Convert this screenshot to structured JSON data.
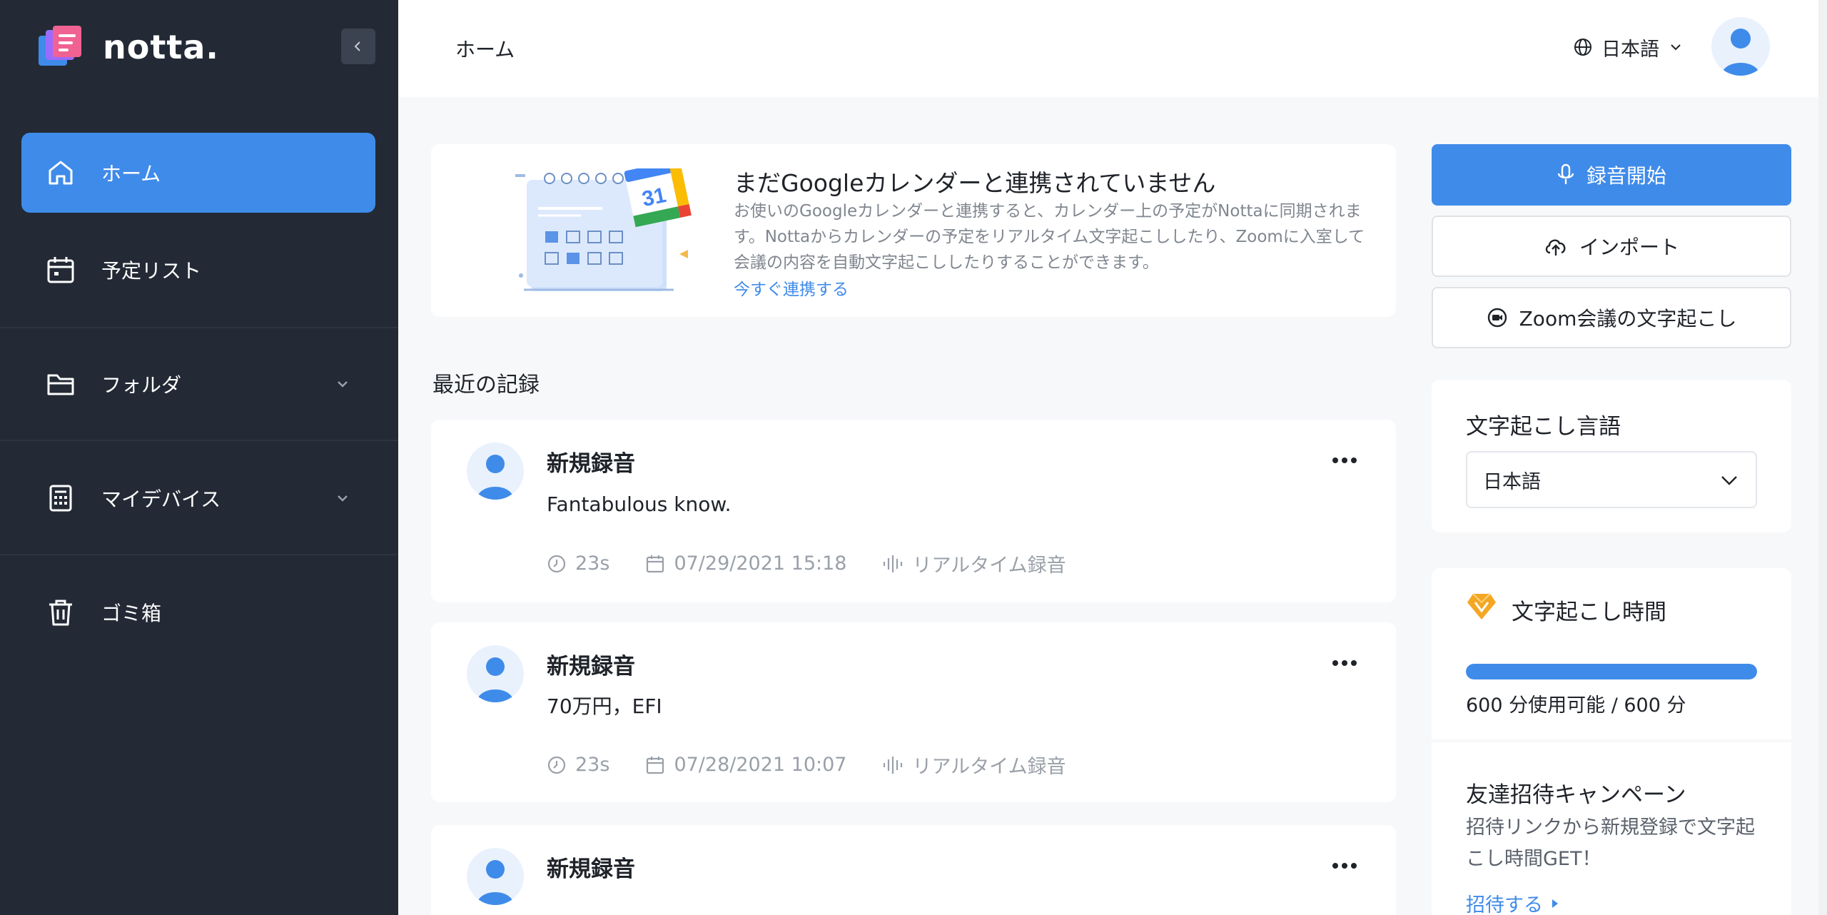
{
  "app": {
    "logo_text": "notta.",
    "brand_color": "#3f8bea",
    "sidebar_bg": "#232a35"
  },
  "sidebar": {
    "items": [
      {
        "label": "ホーム",
        "icon": "home-icon",
        "active": true
      },
      {
        "label": "予定リスト",
        "icon": "calendar-icon"
      },
      {
        "label": "フォルダ",
        "icon": "folder-icon",
        "expandable": true
      },
      {
        "label": "マイデバイス",
        "icon": "device-icon",
        "expandable": true
      },
      {
        "label": "ゴミ箱",
        "icon": "trash-icon"
      }
    ]
  },
  "header": {
    "title": "ホーム",
    "language": "日本語"
  },
  "banner": {
    "title": "まだGoogleカレンダーと連携されていません",
    "description": "お使いのGoogleカレンダーと連携すると、カレンダー上の予定がNottaに同期されます。Nottaからカレンダーの予定をリアルタイム文字起こししたり、Zoomに入室して会議の内容を自動文字起こししたりすることができます。",
    "link": "今すぐ連携する",
    "calendar_day": "31"
  },
  "recent": {
    "title": "最近の記録",
    "records": [
      {
        "title": "新規録音",
        "text": "Fantabulous know.",
        "duration": "23s",
        "date": "07/29/2021 15:18",
        "type": "リアルタイム録音"
      },
      {
        "title": "新規録音",
        "text": "70万円，EFI",
        "duration": "23s",
        "date": "07/28/2021 10:07",
        "type": "リアルタイム録音"
      },
      {
        "title": "新規録音"
      }
    ]
  },
  "actions": {
    "record": "録音開始",
    "import": "インポート",
    "zoom": "Zoom会議の文字起こし"
  },
  "transcription_language": {
    "title": "文字起こし言語",
    "selected": "日本語"
  },
  "transcription_time": {
    "title": "文字起こし時間",
    "usage": "600 分使用可能 / 600 分",
    "progress_percent": 100
  },
  "invite": {
    "title": "友達招待キャンペーン",
    "description": "招待リンクから新規登録で文字起こし時間GET！",
    "link": "招待する"
  }
}
